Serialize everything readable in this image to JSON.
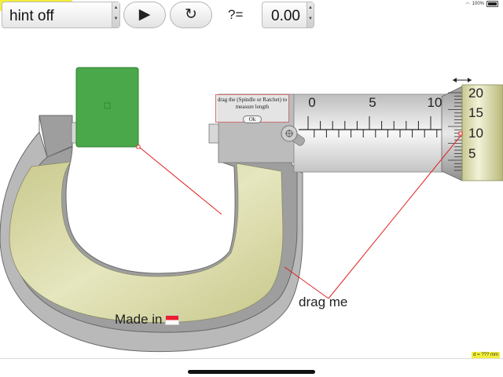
{
  "status_bar": {
    "battery_text": "100%",
    "tag_text": "..."
  },
  "toolbar": {
    "hint_select_value": "hint off",
    "play_icon": "play-icon",
    "reset_icon": "refresh-icon",
    "answer_prefix": "?=",
    "answer_value": "0.00"
  },
  "micrometer": {
    "hint_text": "drag the (Spindle or Ratchet) to measure length",
    "ok_label": "Ok",
    "drag_label": "drag me",
    "made_in_label": "Made in",
    "flag_icon": "singapore-flag-icon",
    "lock_icon": "lock-knob-icon",
    "object_icon": "object-center-icon",
    "main_scale_labels": [
      "0",
      "5",
      "10"
    ],
    "thimble_labels": [
      "20",
      "15",
      "10",
      "5"
    ],
    "d_readout": "d = ??? mm",
    "colors": {
      "frame": "#9e9e9e",
      "grip": "#d9d9a5",
      "object": "#4aa84a",
      "hint_line": "#e02020"
    }
  }
}
